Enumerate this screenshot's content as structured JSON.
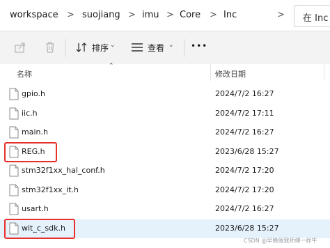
{
  "breadcrumb": {
    "items": [
      "workspace",
      "suojiang",
      "imu",
      "Core",
      "Inc"
    ],
    "separator": ">"
  },
  "search": {
    "label": "在 Inc"
  },
  "toolbar": {
    "sort_label": "排序",
    "view_label": "查看",
    "more_label": "•••"
  },
  "columns": {
    "name": "名称",
    "modified": "修改日期"
  },
  "files": [
    {
      "name": "gpio.h",
      "date": "2024/7/2 16:27",
      "highlighted": false,
      "selected": false
    },
    {
      "name": "iic.h",
      "date": "2024/7/2 17:11",
      "highlighted": false,
      "selected": false
    },
    {
      "name": "main.h",
      "date": "2024/7/2 16:27",
      "highlighted": false,
      "selected": false
    },
    {
      "name": "REG.h",
      "date": "2023/6/28 15:27",
      "highlighted": true,
      "selected": false
    },
    {
      "name": "stm32f1xx_hal_conf.h",
      "date": "2024/7/2 17:20",
      "highlighted": false,
      "selected": false
    },
    {
      "name": "stm32f1xx_it.h",
      "date": "2024/7/2 17:20",
      "highlighted": false,
      "selected": false
    },
    {
      "name": "usart.h",
      "date": "2024/7/2 16:27",
      "highlighted": false,
      "selected": false
    },
    {
      "name": "wit_c_sdk.h",
      "date": "2023/6/28 15:27",
      "highlighted": true,
      "selected": true
    }
  ],
  "watermark": "CSDN @早晚做我师傅一样牛",
  "colors": {
    "highlight_border": "#e8302a",
    "selected_row": "#e5f1fb"
  }
}
